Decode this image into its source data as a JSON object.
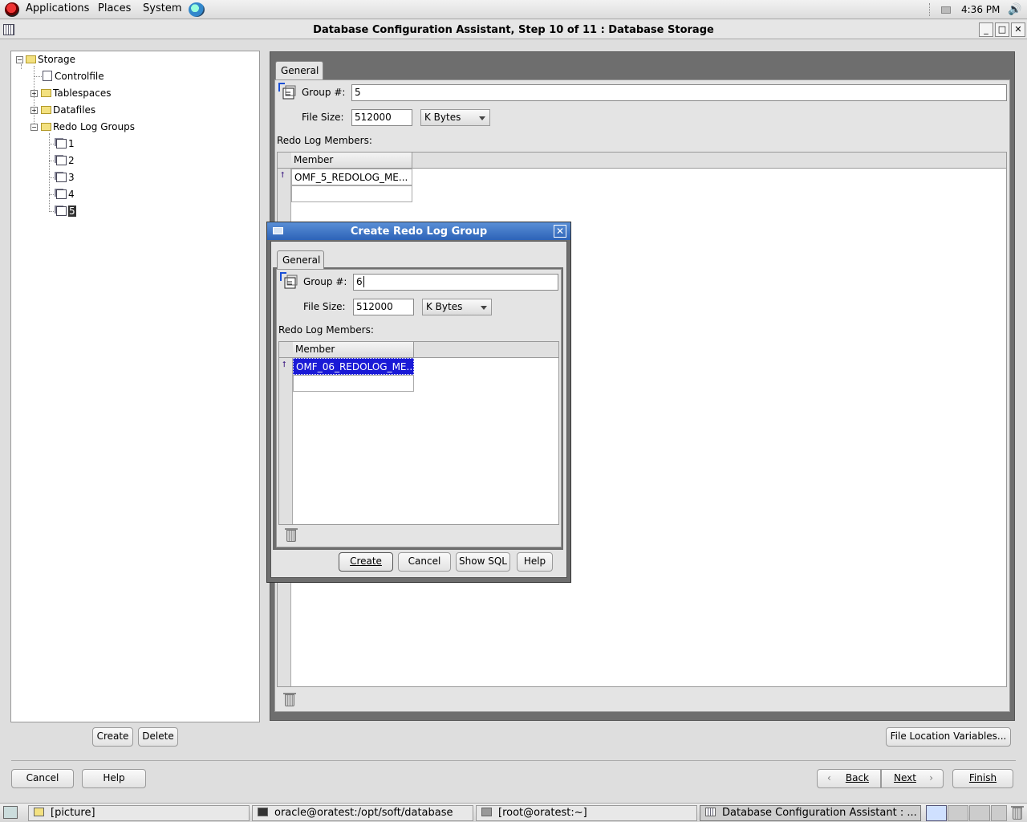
{
  "top_panel": {
    "menus": [
      "Applications",
      "Places",
      "System"
    ],
    "clock": "4:36 PM"
  },
  "window": {
    "title": "Database Configuration Assistant, Step 10 of 11 : Database Storage",
    "controls": [
      "_",
      "□",
      "✕"
    ]
  },
  "tree": {
    "root": "Storage",
    "items": [
      "Controlfile",
      "Tablespaces",
      "Datafiles",
      "Redo Log Groups"
    ],
    "groups": [
      "1",
      "2",
      "3",
      "4",
      "5"
    ],
    "selected": "5"
  },
  "tree_buttons": {
    "create": "Create",
    "delete": "Delete"
  },
  "main_form": {
    "tab": "General",
    "group_label": "Group #:",
    "group_value": "5",
    "file_size_label": "File Size:",
    "file_size_value": "512000",
    "unit": "K Bytes",
    "members_label": "Redo Log Members:",
    "member_header": "Member",
    "members": [
      "OMF_5_REDOLOG_ME..."
    ]
  },
  "dialog": {
    "title": "Create Redo Log Group",
    "tab": "General",
    "group_label": "Group #:",
    "group_value": "6",
    "file_size_label": "File Size:",
    "file_size_value": "512000",
    "unit": "K Bytes",
    "members_label": "Redo Log Members:",
    "member_header": "Member",
    "members": [
      "OMF_06_REDOLOG_ME..."
    ],
    "buttons": {
      "create": "Create",
      "cancel": "Cancel",
      "show_sql": "Show SQL",
      "help": "Help"
    }
  },
  "file_location_button": "File Location Variables...",
  "footer": {
    "cancel": "Cancel",
    "help": "Help",
    "back": "Back",
    "next": "Next",
    "finish": "Finish"
  },
  "taskbar": {
    "tasks": [
      "[picture]",
      "oracle@oratest:/opt/soft/database",
      "[root@oratest:~]",
      "Database Configuration Assistant : ..."
    ]
  }
}
